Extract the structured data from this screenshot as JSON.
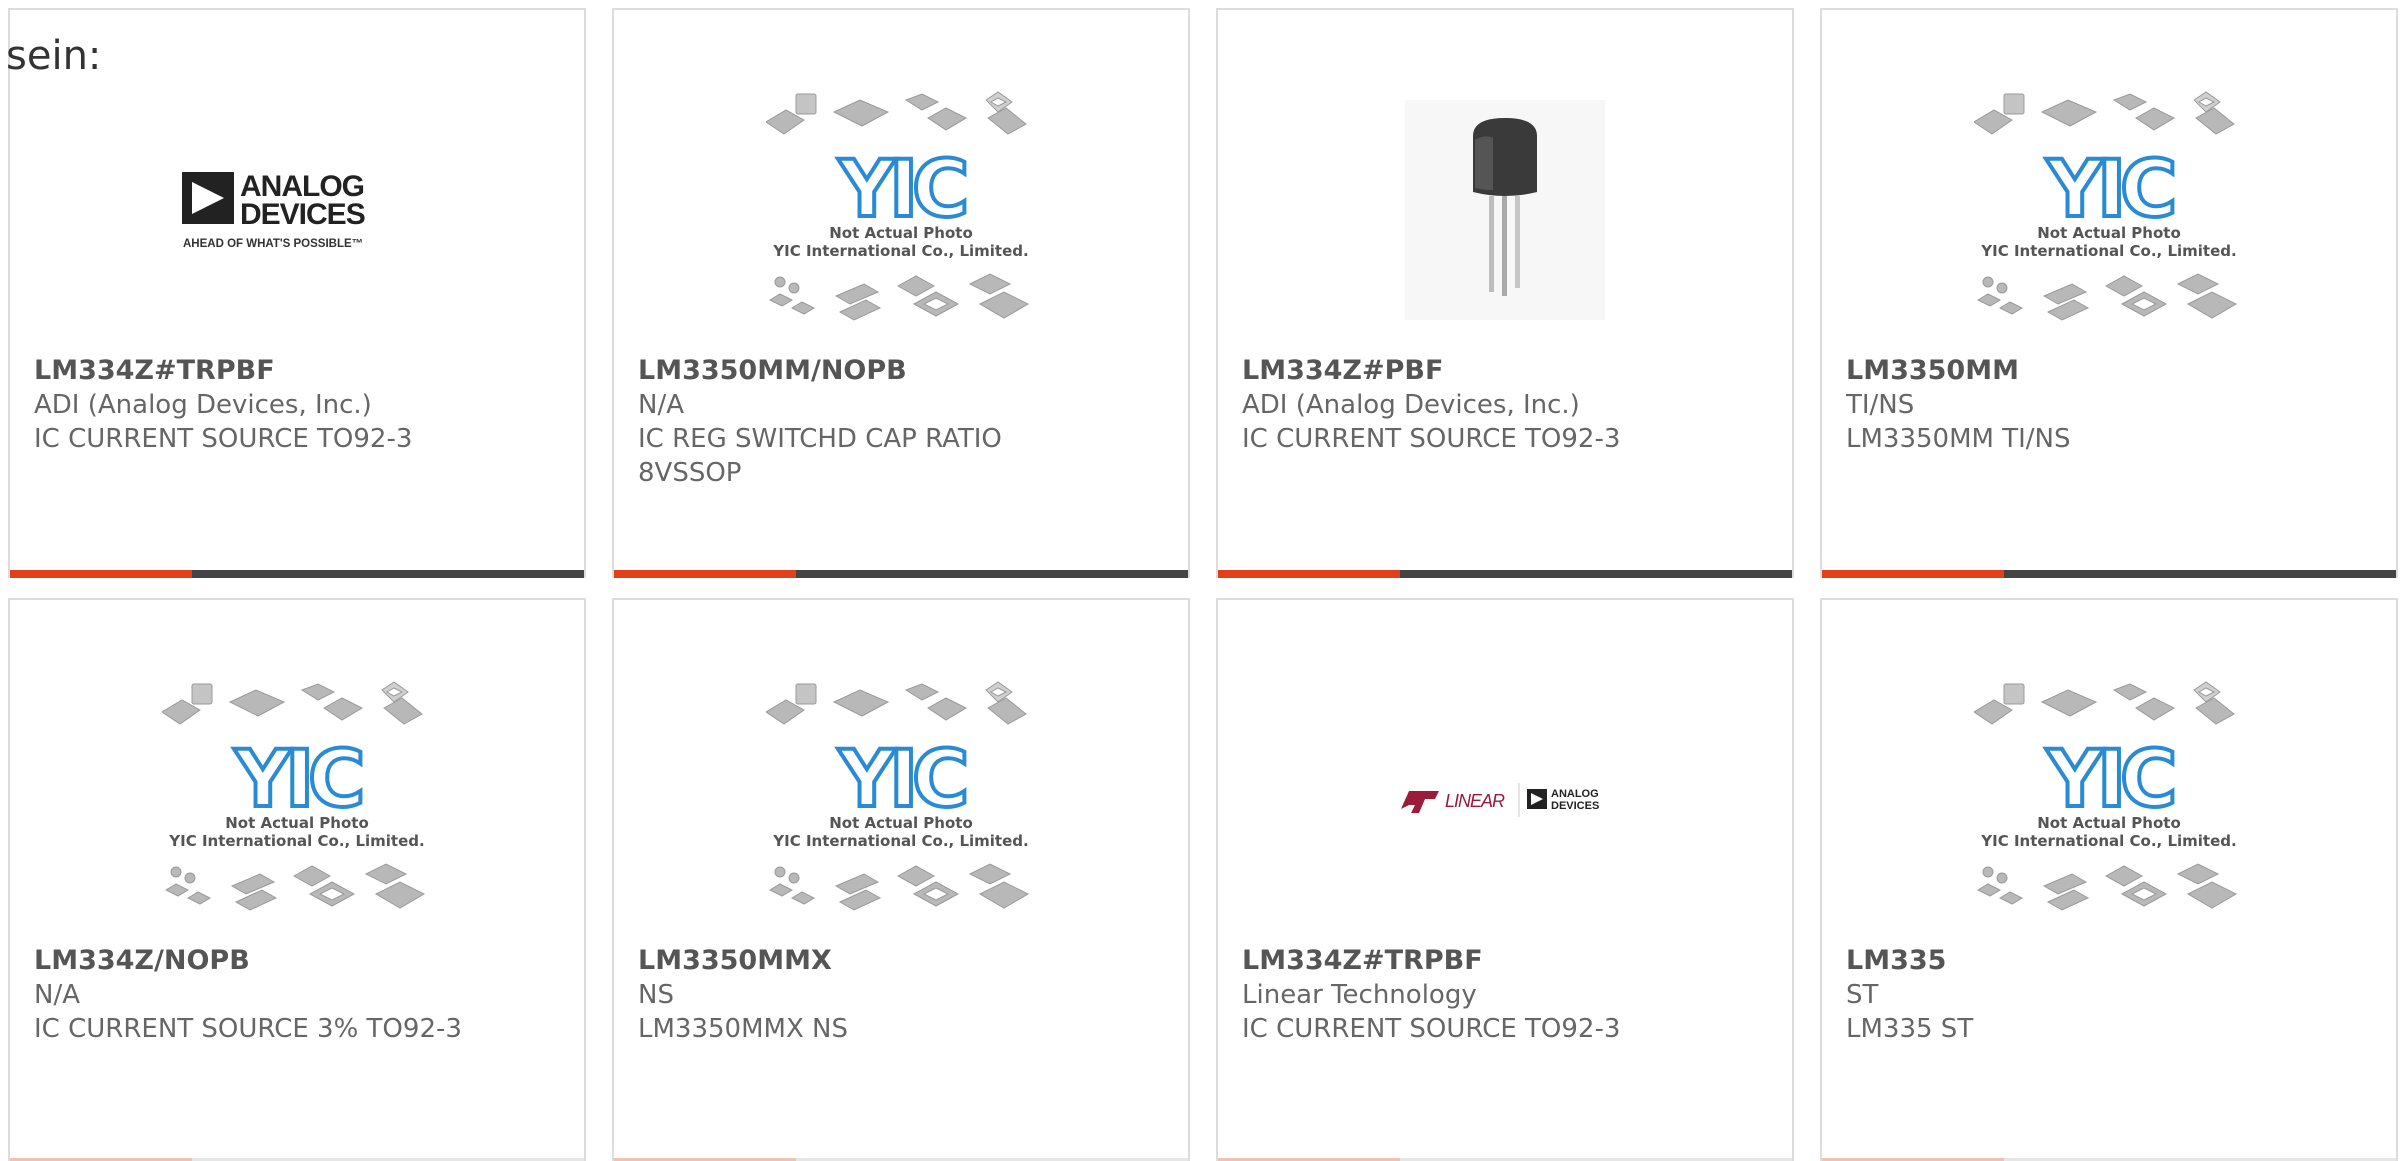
{
  "intro_text": "sein:",
  "placeholder": {
    "logo": "YIC",
    "line1": "Not Actual Photo",
    "line2": "YIC International Co., Limited."
  },
  "logos": {
    "adi_line1": "ANALOG",
    "adi_line2": "DEVICES",
    "adi_tagline": "AHEAD OF WHAT'S POSSIBLE™",
    "linear_brand": "LINEAR",
    "linear_adi_line1": "ANALOG",
    "linear_adi_line2": "DEVICES"
  },
  "colors": {
    "accent": "#e0401a",
    "bar_dark": "#444444",
    "card_border": "#dddddd",
    "yic_blue": "#2a8bd4",
    "chip_gray": "#b8b8b8"
  },
  "products": [
    {
      "part": "LM334Z#TRPBF",
      "manufacturer": "ADI (Analog Devices, Inc.)",
      "description": "IC CURRENT SOURCE TO92-3",
      "image": "analog-devices-logo"
    },
    {
      "part": "LM3350MM/NOPB",
      "manufacturer": "N/A",
      "description": "IC REG SWITCHD CAP RATIO 8VSSOP",
      "image": "placeholder"
    },
    {
      "part": "LM334Z#PBF",
      "manufacturer": "ADI (Analog Devices, Inc.)",
      "description": "IC CURRENT SOURCE TO92-3",
      "image": "to92-transistor"
    },
    {
      "part": "LM3350MM",
      "manufacturer": "TI/NS",
      "description": "LM3350MM TI/NS",
      "image": "placeholder"
    },
    {
      "part": "LM334Z/NOPB",
      "manufacturer": "N/A",
      "description": "IC CURRENT SOURCE 3% TO92-3",
      "image": "placeholder"
    },
    {
      "part": "LM3350MMX",
      "manufacturer": "NS",
      "description": "LM3350MMX NS",
      "image": "placeholder"
    },
    {
      "part": "LM334Z#TRPBF",
      "manufacturer": "Linear Technology",
      "description": "IC CURRENT SOURCE TO92-3",
      "image": "linear-adi-logo"
    },
    {
      "part": "LM335",
      "manufacturer": "ST",
      "description": "LM335 ST",
      "image": "placeholder"
    }
  ]
}
